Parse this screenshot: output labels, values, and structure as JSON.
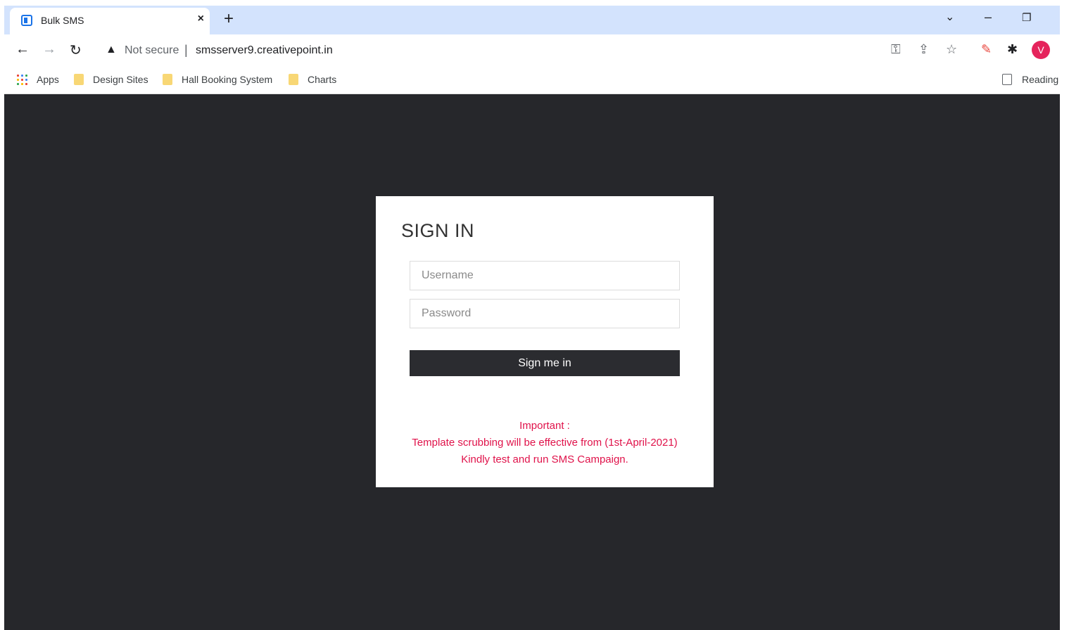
{
  "browser": {
    "tab_title": "Bulk SMS",
    "tab_close": "×",
    "new_tab": "+",
    "window_controls": {
      "chevron": "⌄",
      "minimize": "–",
      "restore": "❐"
    },
    "nav": {
      "back": "←",
      "forward": "→",
      "reload": "↻"
    },
    "security_label": "Not secure",
    "separator": "|",
    "url": "smsserver9.creativepoint.in",
    "profile_initial": "V",
    "toolbar_icons": [
      "key-icon",
      "share-icon",
      "star-icon",
      "paint-icon",
      "extensions-icon"
    ]
  },
  "bookmarks": {
    "apps": "Apps",
    "items": [
      "Design Sites",
      "Hall Booking System",
      "Charts"
    ],
    "reading": "Reading"
  },
  "login": {
    "title": "SIGN IN",
    "username_placeholder": "Username",
    "password_placeholder": "Password",
    "submit_label": "Sign me in",
    "notice_heading": "Important :",
    "notice_line1": "Template scrubbing will be effective from (1st-April-2021)",
    "notice_line2": "Kindly test and run SMS Campaign."
  },
  "colors": {
    "page_background": "#26272b",
    "button_background": "#2b2c30",
    "notice_text": "#e0124a",
    "avatar": "#e5245c"
  }
}
